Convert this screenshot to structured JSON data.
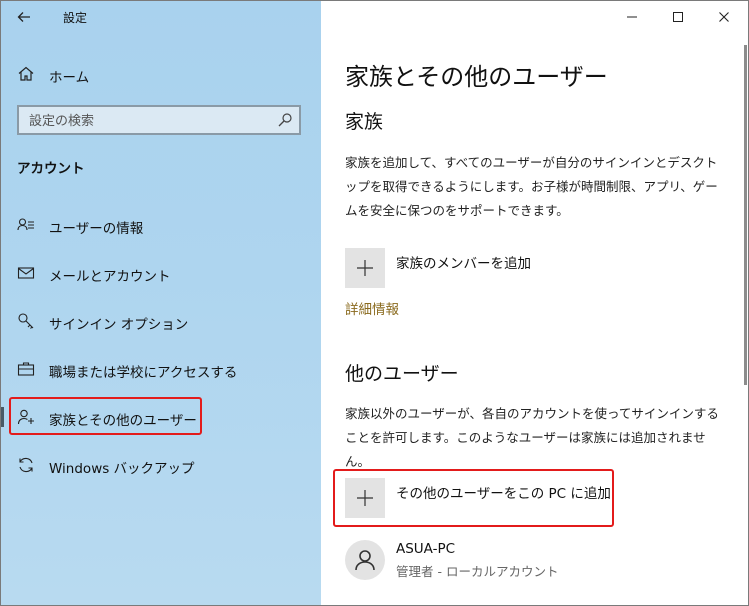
{
  "window": {
    "title": "設定",
    "controls": [
      "minimize",
      "maximize",
      "close"
    ]
  },
  "sidebar": {
    "home_label": "ホーム",
    "home_icon": "home-icon",
    "search_placeholder": "設定の検索",
    "section_heading": "アカウント",
    "items": [
      {
        "label": "ユーザーの情報",
        "icon": "user-info-icon"
      },
      {
        "label": "メールとアカウント",
        "icon": "mail-icon"
      },
      {
        "label": "サインイン オプション",
        "icon": "key-icon"
      },
      {
        "label": "職場または学校にアクセスする",
        "icon": "briefcase-icon"
      },
      {
        "label": "家族とその他のユーザー",
        "icon": "add-person-icon",
        "selected": true
      },
      {
        "label": "Windows バックアップ",
        "icon": "sync-icon"
      }
    ]
  },
  "main": {
    "page_title": "家族とその他のユーザー",
    "family": {
      "heading": "家族",
      "description": "家族を追加して、すべてのユーザーが自分のサインインとデスクトップを取得できるようにします。お子様が時間制限、アプリ、ゲームを安全に保つのをサポートできます。",
      "add_label": "家族のメンバーを追加",
      "more_info": "詳細情報"
    },
    "other_users": {
      "heading": "他のユーザー",
      "description": "家族以外のユーザーが、各自のアカウントを使ってサインインすることを許可します。このようなユーザーは家族には追加されません。",
      "add_label": "その他のユーザーをこの PC に追加",
      "users": [
        {
          "name": "ASUA-PC",
          "subtitle": "管理者 - ローカルアカウント"
        }
      ]
    }
  },
  "colors": {
    "sidebar_bg": "#aed5ef",
    "highlight": "#e31b1b",
    "link": "#8a6a1e",
    "tile": "#e3e3e3"
  }
}
